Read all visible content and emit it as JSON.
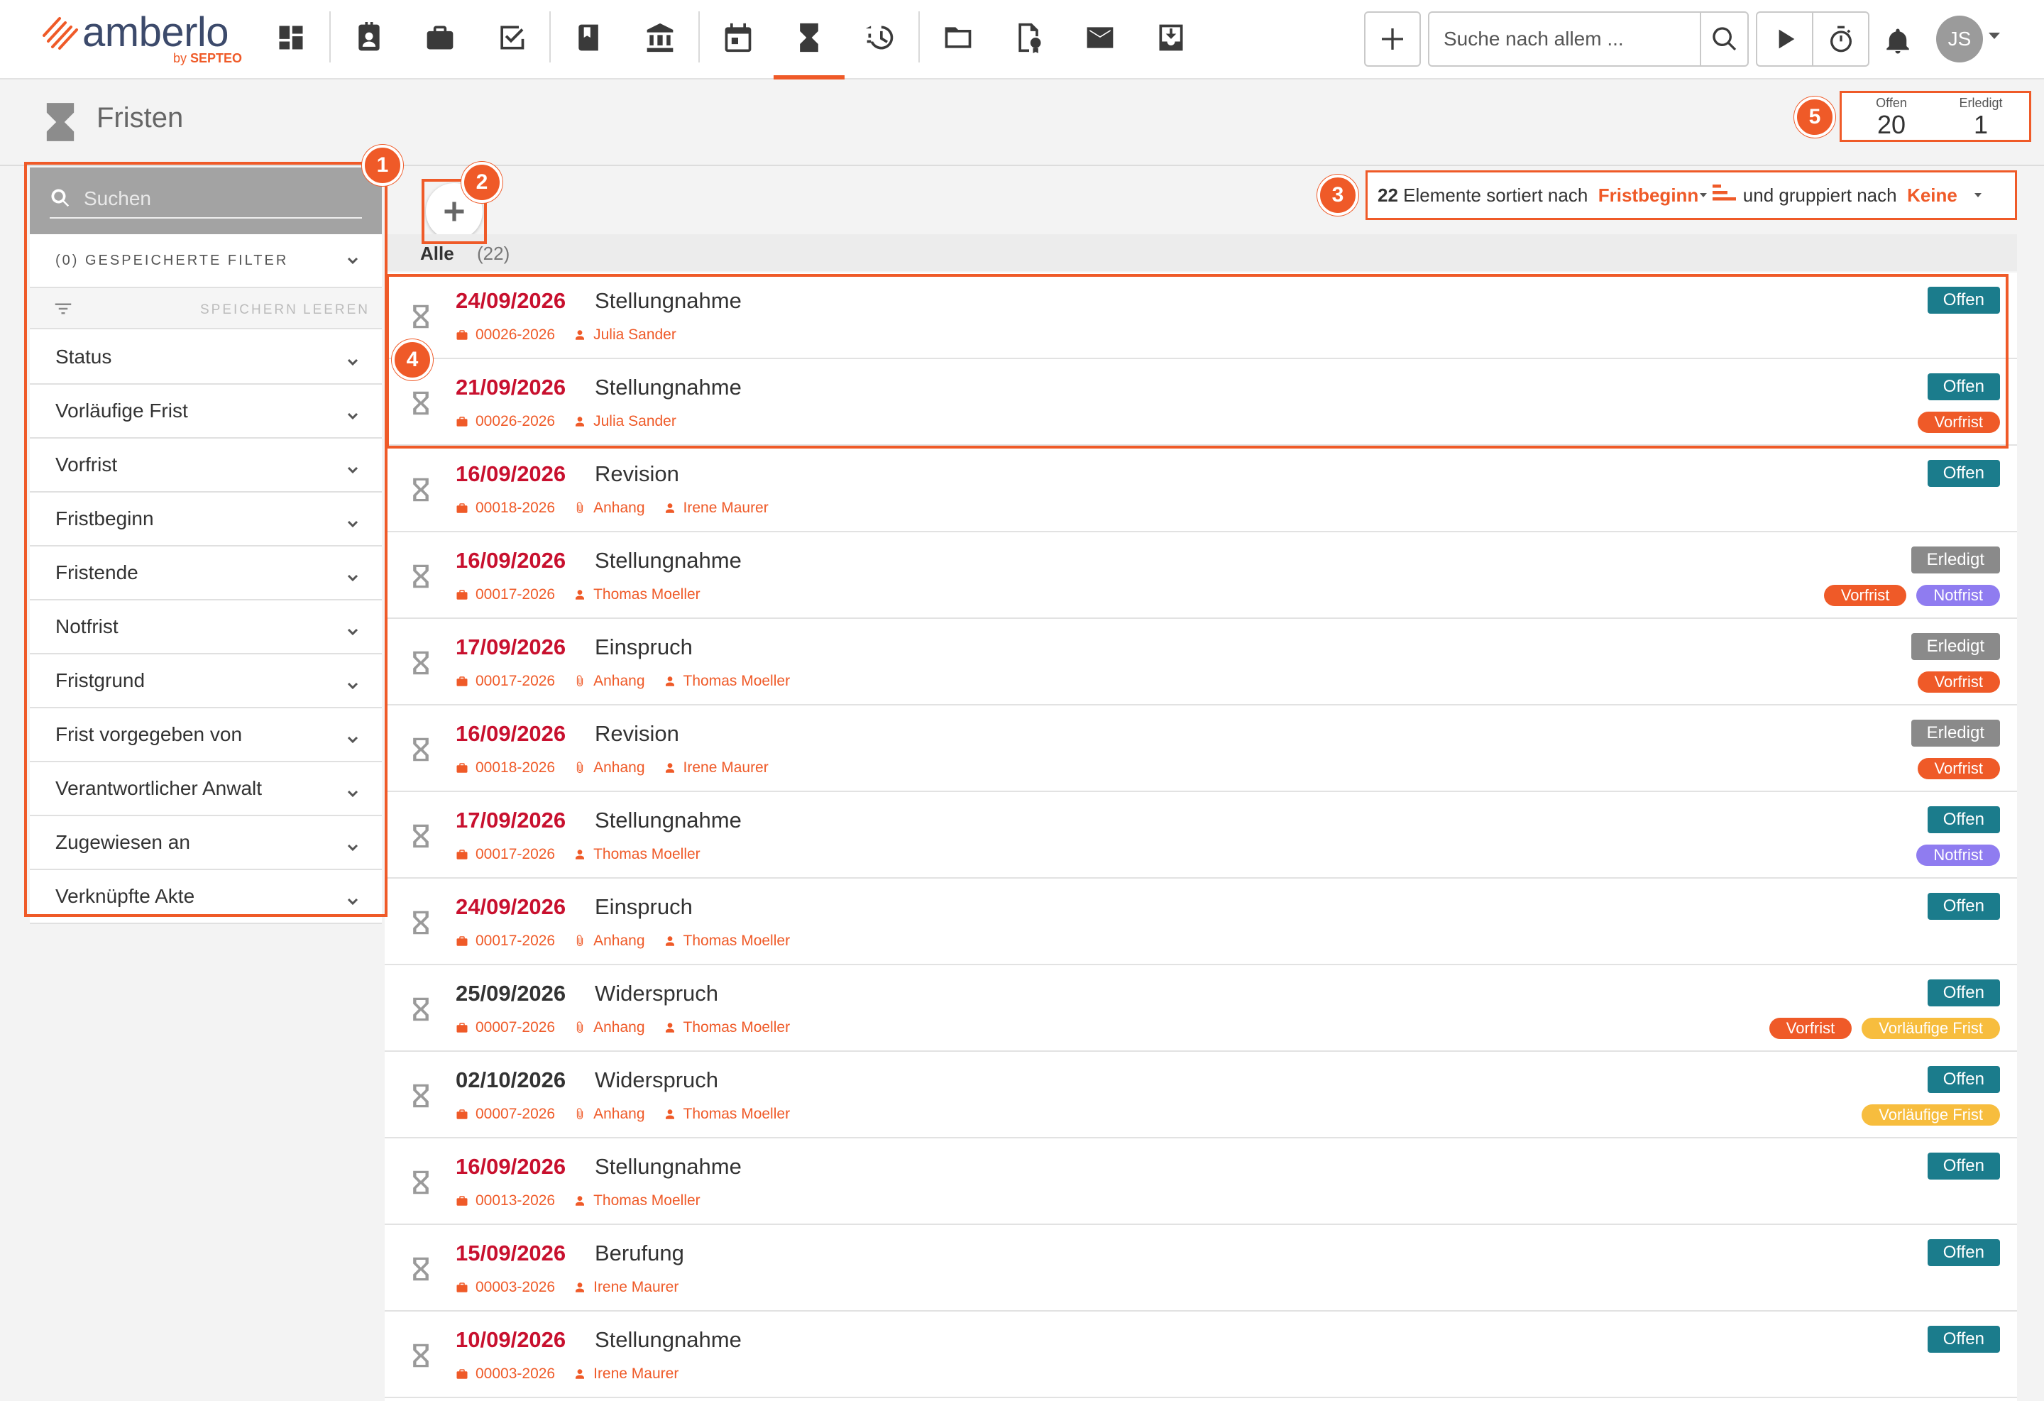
{
  "brand": {
    "name": "amberlo",
    "by": "by",
    "sub": "SEPTEO",
    "accent": "#ef5a28",
    "logo_color": "#3c4a6b"
  },
  "nav": {
    "items": [
      {
        "icon": "dashboard-icon",
        "name": "nav-dashboard"
      },
      {
        "icon": "contacts-icon",
        "name": "nav-contacts"
      },
      {
        "icon": "briefcase-icon",
        "name": "nav-matters"
      },
      {
        "icon": "tasks-icon",
        "name": "nav-tasks"
      },
      {
        "icon": "book-icon",
        "name": "nav-library"
      },
      {
        "icon": "court-icon",
        "name": "nav-court"
      },
      {
        "icon": "calendar-icon",
        "name": "nav-calendar"
      },
      {
        "icon": "hourglass-icon",
        "name": "nav-deadlines",
        "active": true
      },
      {
        "icon": "time-billing-icon",
        "name": "nav-time-billing"
      },
      {
        "icon": "folder-icon",
        "name": "nav-documents"
      },
      {
        "icon": "document-seal-icon",
        "name": "nav-templates"
      },
      {
        "icon": "mail-icon",
        "name": "nav-mail"
      },
      {
        "icon": "inbox-download-icon",
        "name": "nav-inbox"
      }
    ],
    "search_placeholder": "Suche nach allem ...",
    "user_initials": "JS"
  },
  "page": {
    "title": "Fristen",
    "counters": [
      {
        "label": "Offen",
        "value": "20"
      },
      {
        "label": "Erledigt",
        "value": "1"
      }
    ]
  },
  "sidebar": {
    "search_placeholder": "Suchen",
    "saved_filters": "(0) GESPEICHERTE FILTER",
    "save_label": "SPEICHERN",
    "clear_label": "LEEREN",
    "filters": [
      "Status",
      "Vorläufige Frist",
      "Vorfrist",
      "Fristbeginn",
      "Fristende",
      "Notfrist",
      "Fristgrund",
      "Frist vorgegeben von",
      "Verantwortlicher Anwalt",
      "Zugewiesen an",
      "Verknüpfte Akte"
    ]
  },
  "toolbar": {
    "count": "22",
    "sorted_by_text": "Elemente sortiert nach",
    "sort_field": "Fristbeginn",
    "grouped_by_text": "und gruppiert nach",
    "group_field": "Keine"
  },
  "tabs": {
    "all_label": "Alle",
    "all_count": "(22)"
  },
  "markers": [
    "1",
    "2",
    "3",
    "4",
    "5"
  ],
  "status_colors": {
    "Offen": "#1b7c8c",
    "Erledigt": "#8a8a8a",
    "Vorfrist": "#ef5a28",
    "Notfrist": "#8f7cf0",
    "Vorläufige Frist": "#f7bd3e"
  },
  "rows": [
    {
      "date": "24/09/2026",
      "date_color": "#c8102e",
      "title": "Stellungnahme",
      "case": "00026-2026",
      "attachment": "",
      "person": "Julia Sander",
      "status": "Offen",
      "pills": []
    },
    {
      "date": "21/09/2026",
      "date_color": "#c8102e",
      "title": "Stellungnahme",
      "case": "00026-2026",
      "attachment": "",
      "person": "Julia Sander",
      "status": "Offen",
      "pills": [
        "Vorfrist"
      ]
    },
    {
      "date": "16/09/2026",
      "date_color": "#c8102e",
      "title": "Revision",
      "case": "00018-2026",
      "attachment": "Anhang",
      "person": "Irene Maurer",
      "status": "Offen",
      "pills": []
    },
    {
      "date": "16/09/2026",
      "date_color": "#c8102e",
      "title": "Stellungnahme",
      "case": "00017-2026",
      "attachment": "",
      "person": "Thomas Moeller",
      "status": "Erledigt",
      "pills": [
        "Vorfrist",
        "Notfrist"
      ]
    },
    {
      "date": "17/09/2026",
      "date_color": "#c8102e",
      "title": "Einspruch",
      "case": "00017-2026",
      "attachment": "Anhang",
      "person": "Thomas Moeller",
      "status": "Erledigt",
      "pills": [
        "Vorfrist"
      ]
    },
    {
      "date": "16/09/2026",
      "date_color": "#c8102e",
      "title": "Revision",
      "case": "00018-2026",
      "attachment": "Anhang",
      "person": "Irene Maurer",
      "status": "Erledigt",
      "pills": [
        "Vorfrist"
      ]
    },
    {
      "date": "17/09/2026",
      "date_color": "#c8102e",
      "title": "Stellungnahme",
      "case": "00017-2026",
      "attachment": "",
      "person": "Thomas Moeller",
      "status": "Offen",
      "pills": [
        "Notfrist"
      ]
    },
    {
      "date": "24/09/2026",
      "date_color": "#c8102e",
      "title": "Einspruch",
      "case": "00017-2026",
      "attachment": "Anhang",
      "person": "Thomas Moeller",
      "status": "Offen",
      "pills": []
    },
    {
      "date": "25/09/2026",
      "date_color": "#333333",
      "title": "Widerspruch",
      "case": "00007-2026",
      "attachment": "Anhang",
      "person": "Thomas Moeller",
      "status": "Offen",
      "pills": [
        "Vorfrist",
        "Vorläufige Frist"
      ]
    },
    {
      "date": "02/10/2026",
      "date_color": "#333333",
      "title": "Widerspruch",
      "case": "00007-2026",
      "attachment": "Anhang",
      "person": "Thomas Moeller",
      "status": "Offen",
      "pills": [
        "Vorläufige Frist"
      ]
    },
    {
      "date": "16/09/2026",
      "date_color": "#c8102e",
      "title": "Stellungnahme",
      "case": "00013-2026",
      "attachment": "",
      "person": "Thomas Moeller",
      "status": "Offen",
      "pills": []
    },
    {
      "date": "15/09/2026",
      "date_color": "#c8102e",
      "title": "Berufung",
      "case": "00003-2026",
      "attachment": "",
      "person": "Irene Maurer",
      "status": "Offen",
      "pills": []
    },
    {
      "date": "10/09/2026",
      "date_color": "#c8102e",
      "title": "Stellungnahme",
      "case": "00003-2026",
      "attachment": "",
      "person": "Irene Maurer",
      "status": "Offen",
      "pills": []
    }
  ]
}
